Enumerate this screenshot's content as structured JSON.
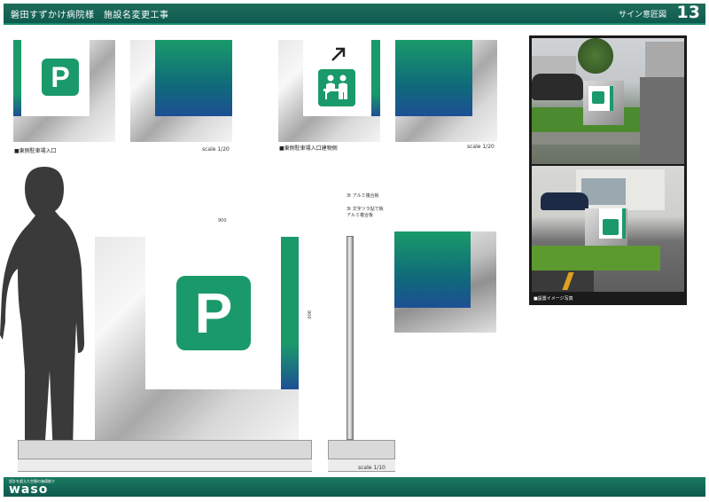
{
  "header": {
    "title": "磐田すずかけ病院様　施設名変更工事",
    "section": "サイン意匠図",
    "page_number": "13"
  },
  "views": {
    "east_parking": {
      "caption": "■東側駐車場入口",
      "scale": "scale 1/20",
      "icon_letter": "P"
    },
    "east_parking_building": {
      "caption": "■東側駐車場入口建物側",
      "scale": "scale 1/20"
    },
    "detail": {
      "width_dim": "900",
      "height_dim": "900",
      "icon_letter": "P",
      "note_1": "3t アルミ複合板",
      "note_2": "3t 文字ツラ貼で板",
      "note_3": "アルミ複合板",
      "scale": "scale 1/10"
    }
  },
  "photo": {
    "caption": "■設置イメージ写真"
  },
  "footer": {
    "tagline": "設計を超えた空間の価値創り",
    "logo": "waso"
  },
  "colors": {
    "brand_green": "#1a9a6a",
    "brand_blue": "#1d4f94",
    "header_green": "#0f5a50"
  },
  "icons": [
    "parking-icon",
    "arrow-up-right-icon",
    "reception-icon",
    "person-silhouette-icon"
  ]
}
